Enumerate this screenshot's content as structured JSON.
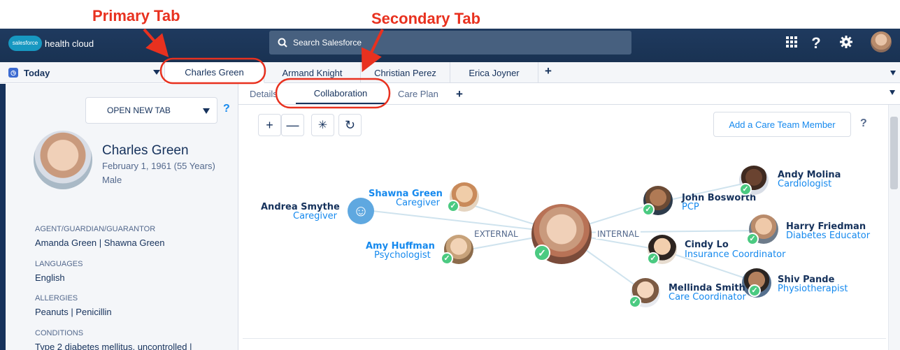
{
  "annotations": {
    "primary": "Primary Tab",
    "secondary": "Secondary Tab",
    "accent": "#e8311f"
  },
  "header": {
    "logo_cloud": "salesforce",
    "logo_text": "health cloud",
    "search_placeholder": "Search Salesforce",
    "icons": [
      "app-launcher-icon",
      "help-icon",
      "setup-gear-icon",
      "user-avatar"
    ],
    "help_glyph": "?",
    "color": "#1f3a5f"
  },
  "tabs": {
    "today": "Today",
    "primary": [
      "Charles Green",
      "Armand Knight",
      "Christian Perez",
      "Erica Joyner"
    ],
    "add": "+"
  },
  "subtabs": {
    "items": [
      "Details",
      "Collaboration",
      "Care Plan"
    ],
    "active": "Collaboration",
    "add": "+"
  },
  "sidebar": {
    "open_new_tab": "OPEN NEW TAB",
    "help": "?",
    "patient": {
      "name": "Charles Green",
      "dob": "February 1, 1961 (55 Years)",
      "gender": "Male"
    },
    "sections": [
      {
        "heading": "AGENT/GUARDIAN/GUARANTOR",
        "value": "Amanda Green | Shawna Green"
      },
      {
        "heading": "LANGUAGES",
        "value": "English"
      },
      {
        "heading": "ALLERGIES",
        "value": "Peanuts | Penicillin"
      },
      {
        "heading": "CONDITIONS",
        "value": "Type 2 diabetes mellitus, uncontrolled |"
      }
    ]
  },
  "toolbar": {
    "zoom_in": "+",
    "zoom_out": "—",
    "center": "✳",
    "refresh": "↻",
    "add_member": "Add a Care Team Member",
    "help": "?"
  },
  "network": {
    "external_label": "EXTERNAL",
    "internal_label": "INTERNAL",
    "members": [
      {
        "name": "Andrea Smythe",
        "role": "Caregiver"
      },
      {
        "name": "Shawna Green",
        "role": "Caregiver"
      },
      {
        "name": "Amy Huffman",
        "role": "Psychologist"
      },
      {
        "name": "John Bosworth",
        "role": "PCP"
      },
      {
        "name": "Andy Molina",
        "role": "Cardiologist"
      },
      {
        "name": "Harry Friedman",
        "role": "Diabetes Educator"
      },
      {
        "name": "Cindy Lo",
        "role": "Insurance Coordinator"
      },
      {
        "name": "Shiv Pande",
        "role": "Physiotherapist"
      },
      {
        "name": "Mellinda Smith",
        "role": "Care Coordinator"
      }
    ],
    "colors": {
      "link": "#cfe3ee",
      "check": "#4bca81",
      "name": "#16325c",
      "role": "#1589ee"
    }
  }
}
